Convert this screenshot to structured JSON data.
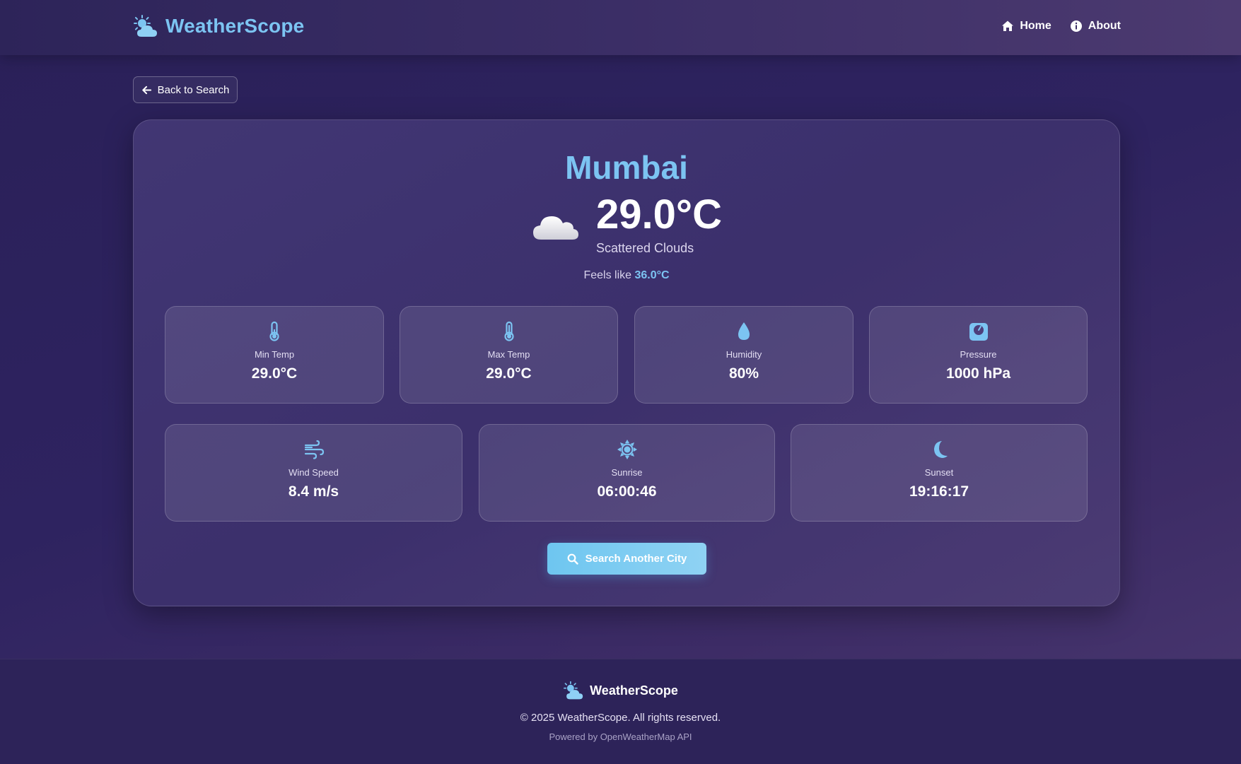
{
  "header": {
    "brand": "WeatherScope",
    "nav": [
      {
        "label": "Home",
        "icon": "home-icon"
      },
      {
        "label": "About",
        "icon": "info-icon"
      }
    ]
  },
  "back_button": {
    "label": "Back to Search",
    "icon": "arrow-left-icon"
  },
  "weather": {
    "city": "Mumbai",
    "temperature": "29.0°C",
    "description": "Scattered Clouds",
    "icon": "cloud-icon",
    "feels_like_label": "Feels like",
    "feels_like_value": "36.0°C"
  },
  "stats": [
    {
      "label": "Min Temp",
      "value": "29.0°C",
      "icon": "thermometer-icon"
    },
    {
      "label": "Max Temp",
      "value": "29.0°C",
      "icon": "thermometer-icon"
    },
    {
      "label": "Humidity",
      "value": "80%",
      "icon": "droplet-icon"
    },
    {
      "label": "Pressure",
      "value": "1000 hPa",
      "icon": "gauge-icon"
    },
    {
      "label": "Wind Speed",
      "value": "8.4 m/s",
      "icon": "wind-icon"
    },
    {
      "label": "Sunrise",
      "value": "06:00:46",
      "icon": "sun-icon"
    },
    {
      "label": "Sunset",
      "value": "19:16:17",
      "icon": "moon-icon"
    }
  ],
  "search_button": {
    "label": "Search Another City",
    "icon": "search-icon"
  },
  "footer": {
    "brand": "WeatherScope",
    "copyright": "© 2025 WeatherScope. All rights reserved.",
    "powered_by": "Powered by OpenWeatherMap API"
  },
  "colors": {
    "accent": "#7cc4f2",
    "background": "#2e2360",
    "button": "#6ec6f0"
  }
}
